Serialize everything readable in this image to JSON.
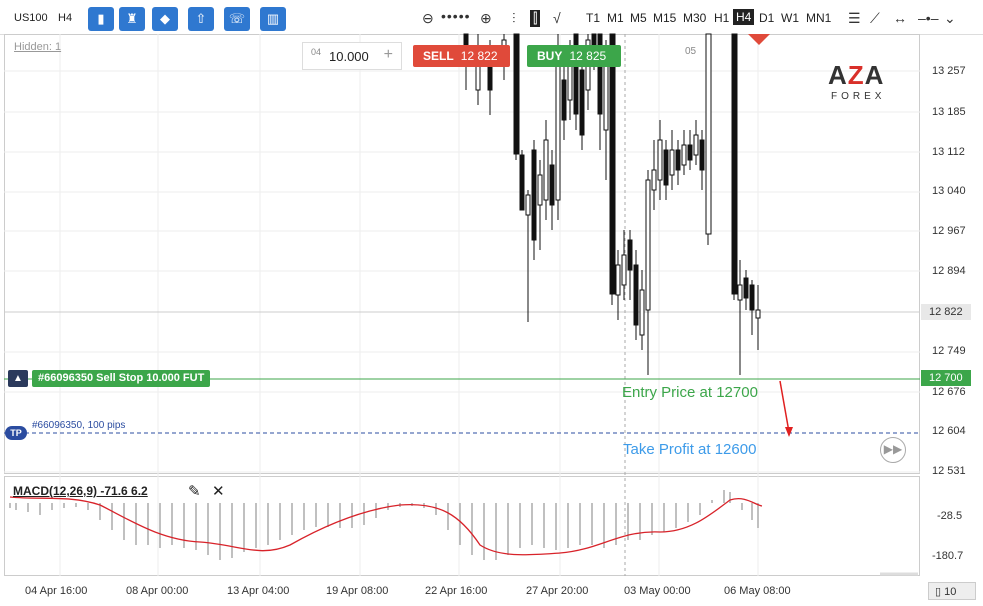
{
  "toolbar": {
    "symbol": "US100",
    "timeframe_current": "H4",
    "timeframes": [
      "T1",
      "M1",
      "M5",
      "M15",
      "M30",
      "H1",
      "H4",
      "D1",
      "W1",
      "MN1"
    ],
    "active_timeframe": "H4"
  },
  "chart": {
    "hidden_label": "Hidden: 1",
    "lot_small": "04",
    "lot_value": "10.000",
    "lot_plus": "+",
    "sell_label": "SELL",
    "sell_price": "12 822",
    "buy_label": "BUY",
    "buy_price": "12 825",
    "marker_05": "05",
    "logo_big": "AZA",
    "logo_small": "FOREX",
    "order_label": "#66096350 Sell Stop 10.000 FUT",
    "tp_badge": "TP",
    "tp_text": "#66096350, 100 pips",
    "entry_annotation": "Entry Price at 12700",
    "tp_annotation": "Take Profit at 12600",
    "current_price": "12 822",
    "order_price": "12 700",
    "price_axis": [
      "13 257",
      "13 185",
      "13 112",
      "13 040",
      "12 967",
      "12 894",
      "12 749",
      "12 676",
      "12 604",
      "12 531"
    ],
    "accent_sell": "#e04a3a",
    "accent_buy": "#3ca64a"
  },
  "macd": {
    "label": "MACD(12,26,9) -71.6 6.2",
    "axis": [
      "-28.5",
      "-180.7"
    ]
  },
  "xaxis": [
    "04 Apr 16:00",
    "08 Apr 00:00",
    "13 Apr 04:00",
    "19 Apr 08:00",
    "22 Apr 16:00",
    "27 Apr 20:00",
    "03 May 00:00",
    "06 May 08:00"
  ],
  "footer": {
    "badge": "10"
  }
}
